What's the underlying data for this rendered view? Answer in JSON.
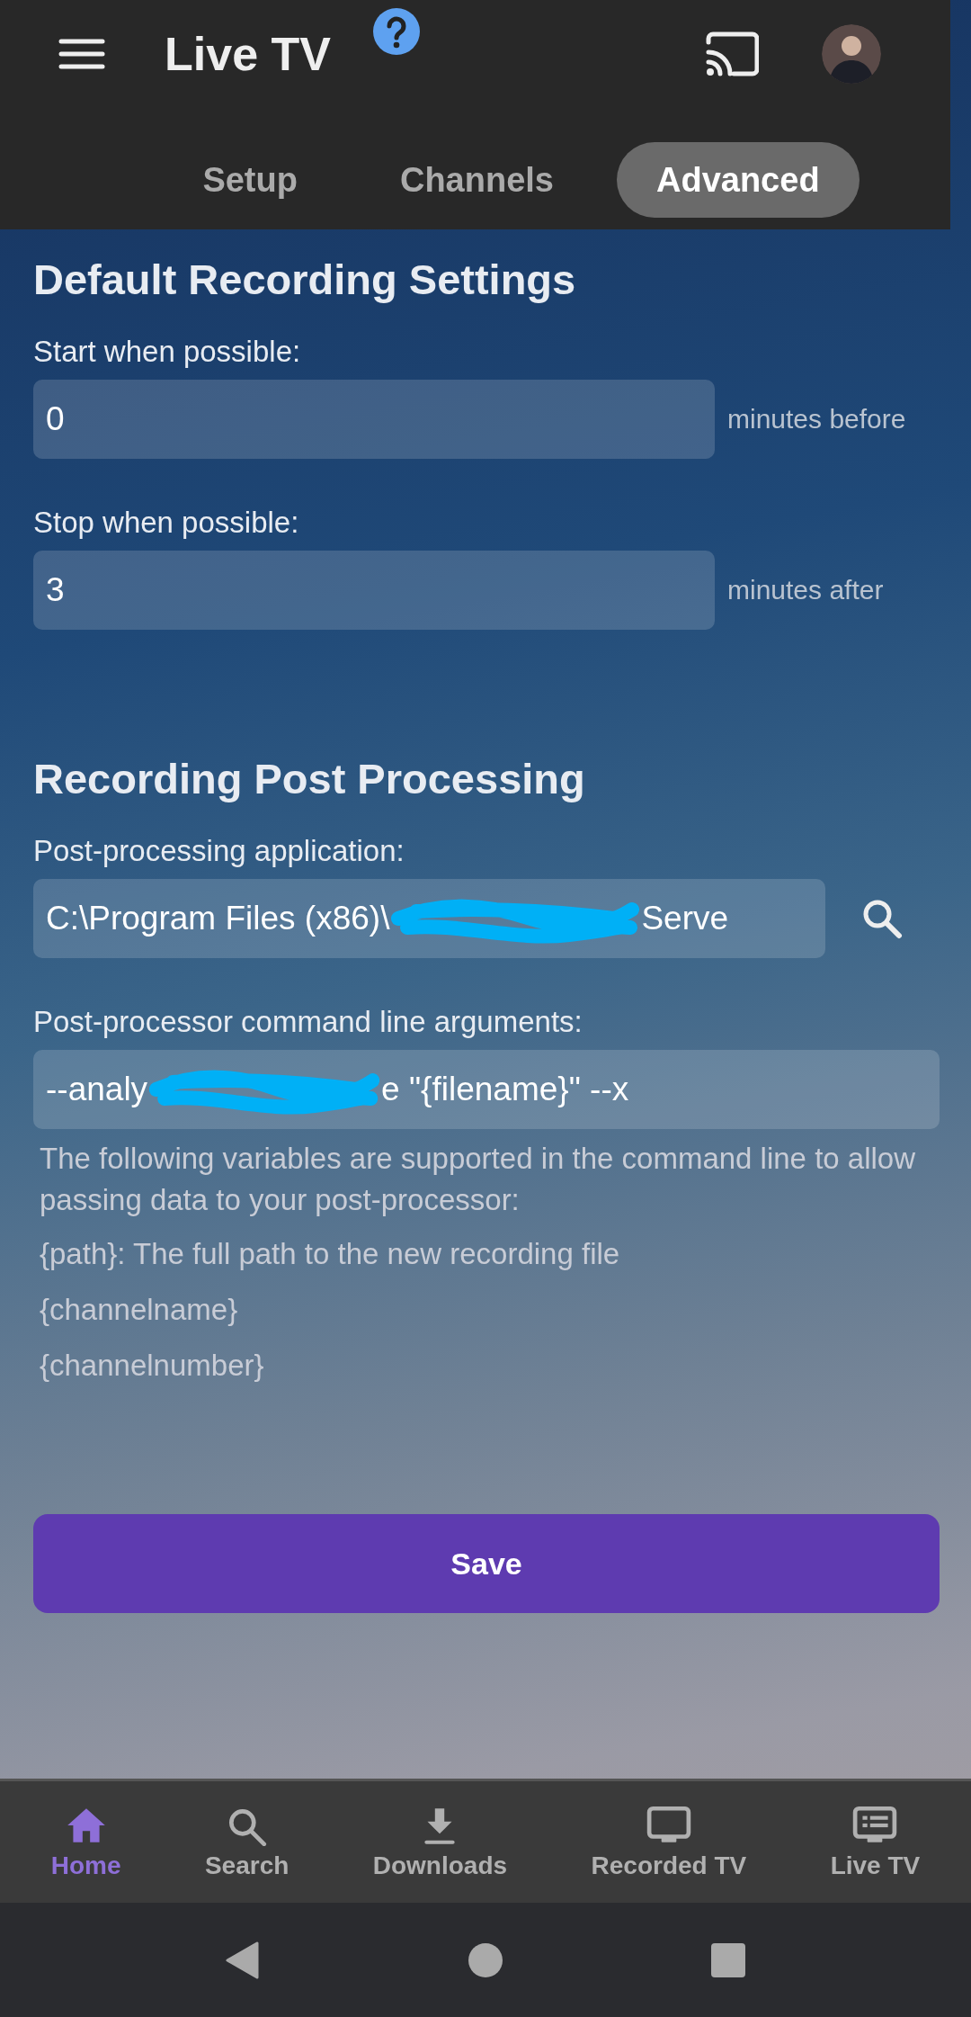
{
  "app_bar": {
    "title": "Live TV"
  },
  "tabs": [
    {
      "label": "Setup",
      "selected": false
    },
    {
      "label": "Channels",
      "selected": false
    },
    {
      "label": "Advanced",
      "selected": true
    }
  ],
  "sections": [
    {
      "heading": "Default Recording Settings",
      "fields": [
        {
          "kind": "number",
          "label": "Start when possible:",
          "value_parts": [
            "0"
          ],
          "suffix": "minutes before"
        },
        {
          "kind": "number",
          "label": "Stop when possible:",
          "value_parts": [
            "3"
          ],
          "suffix": "minutes after"
        }
      ]
    },
    {
      "heading": "Recording Post Processing",
      "fields": [
        {
          "kind": "file",
          "label": "Post-processing application:",
          "value_parts": [
            "C:\\Program Files (x86)\\",
            "Serve"
          ]
        },
        {
          "kind": "text",
          "label": "Post-processor command line arguments:",
          "value_parts": [
            "--analy",
            "e \"{filename}\" --x"
          ]
        }
      ],
      "help_lines": [
        "The following variables are supported in the command line to allow passing data to your post-processor:",
        "{path}: The full path to the new recording file",
        "{channelname}",
        "{channelnumber}"
      ]
    }
  ],
  "save_button": {
    "label": "Save"
  },
  "bottom_nav": [
    {
      "kind": "home",
      "label": "Home",
      "selected": true
    },
    {
      "kind": "search",
      "label": "Search",
      "selected": false
    },
    {
      "kind": "download",
      "label": "Downloads",
      "selected": false
    },
    {
      "kind": "tv",
      "label": "Recorded TV",
      "selected": false
    },
    {
      "kind": "guide",
      "label": "Live TV",
      "selected": false
    }
  ]
}
